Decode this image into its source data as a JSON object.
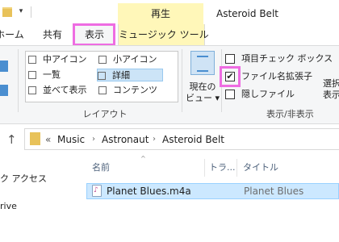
{
  "titlebar": {
    "quick_access_menu": "▾",
    "contextual_header": "再生",
    "window_title": "Asteroid Belt"
  },
  "tabs": [
    {
      "label": "ホーム"
    },
    {
      "label": "共有"
    },
    {
      "label": "表示"
    },
    {
      "label": "ミュージック ツール"
    }
  ],
  "ribbon": {
    "layout_options": [
      {
        "label": "中アイコン"
      },
      {
        "label": "小アイコン"
      },
      {
        "label": "一覧"
      },
      {
        "label": "詳細",
        "selected": true
      },
      {
        "label": "並べて表示"
      },
      {
        "label": "コンテンツ"
      }
    ],
    "layout_group_label": "レイアウト",
    "current_view_label": "現在の",
    "current_view_label2": "ビュー ▾",
    "checkboxes": [
      {
        "label": "項目チェック ボックス",
        "checked": false
      },
      {
        "label": "ファイル名拡張子",
        "checked": true
      },
      {
        "label": "隠しファイル",
        "checked": false
      }
    ],
    "checkmark": "✔",
    "show_hide_label": "表示/非表示",
    "hide_selected_label": "選択",
    "hide_selected_label2": "表示"
  },
  "address": {
    "up_arrow": "↑",
    "overflow": "«",
    "crumbs": [
      "Music",
      "Astronaut",
      "Asteroid Belt"
    ],
    "separator": "›"
  },
  "nav": {
    "quick_access": "ク アクセス",
    "drive": "rive"
  },
  "columns": {
    "name": "名前",
    "track": "トラ...",
    "title": "タイトル"
  },
  "files": [
    {
      "name": "Planet Blues.m4a",
      "title": "Planet Blues"
    }
  ],
  "colors": {
    "highlight": "#ee6ce2",
    "contextual_tab": "#fff7b9",
    "selection": "#cce8ff"
  }
}
